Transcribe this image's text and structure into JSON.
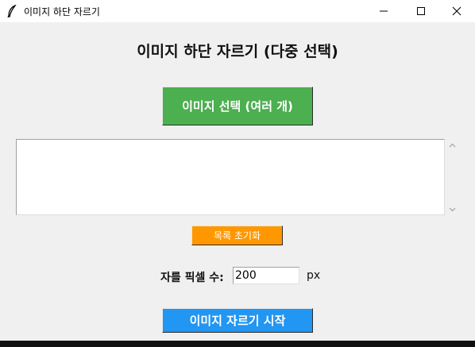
{
  "window": {
    "title": "이미지 하단 자르기",
    "icon": "feather-icon",
    "controls": [
      "minimize-icon",
      "maximize-icon",
      "close-icon"
    ]
  },
  "heading": "이미지 하단 자르기 (다중 선택)",
  "select_button": {
    "label": "이미지 선택 (여러 개)",
    "color": "#4caf50"
  },
  "file_list": {
    "items": []
  },
  "clear_button": {
    "label": "목록 초기화",
    "color": "#ff9800"
  },
  "crop": {
    "label": "자를 픽셀 수:",
    "value": "200",
    "unit": "px"
  },
  "start_button": {
    "label": "이미지 자르기 시작",
    "color": "#2196f3"
  }
}
